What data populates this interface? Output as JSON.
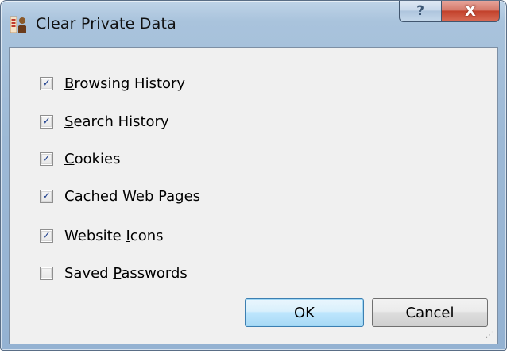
{
  "window": {
    "title": "Clear Private Data",
    "help_glyph": "?",
    "close_glyph": "X",
    "app_icon": "app-icon"
  },
  "options": [
    {
      "pre": "",
      "key": "B",
      "post": "rowsing History",
      "checked": true
    },
    {
      "pre": "",
      "key": "S",
      "post": "earch History",
      "checked": true
    },
    {
      "pre": "",
      "key": "C",
      "post": "ookies",
      "checked": true
    },
    {
      "pre": "Cached ",
      "key": "W",
      "post": "eb Pages",
      "checked": true
    },
    {
      "pre": "Website ",
      "key": "I",
      "post": "cons",
      "checked": true
    },
    {
      "pre": "Saved ",
      "key": "P",
      "post": "asswords",
      "checked": false
    }
  ],
  "buttons": {
    "ok_label": "OK",
    "cancel_label": "Cancel"
  },
  "colors": {
    "title_bar": "#9db9d6",
    "close_button": "#c2412b",
    "check_mark": "#1c3d8c",
    "default_button_border": "#3c7fb1"
  }
}
